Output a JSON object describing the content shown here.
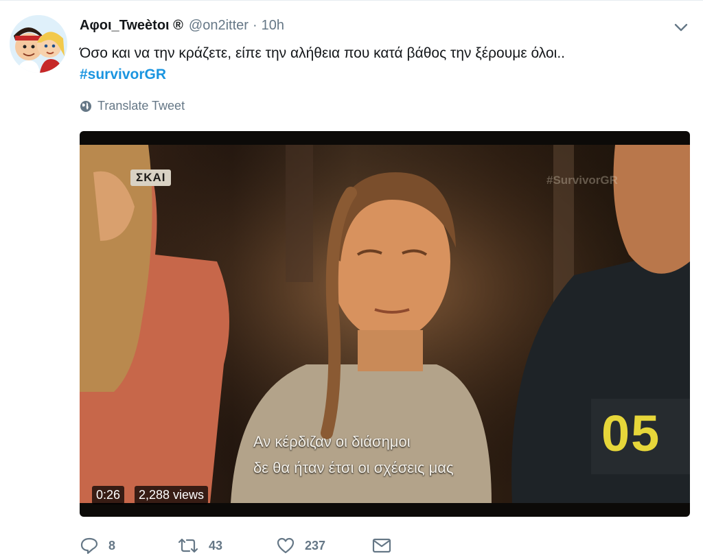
{
  "tweet": {
    "author_name": "Αφοι_Tweètoι ®",
    "handle": "@on2itter",
    "separator": "·",
    "time": "10h",
    "text": "Όσο και να την κράζετε, είπε την αλήθεια που κατά βάθος την ξέρουμε όλοι..",
    "hashtag": "#survivorGR",
    "translate_label": "Translate Tweet"
  },
  "media": {
    "channel_logo": "ΣΚΑΙ",
    "watermark": "#SurvivorGR",
    "subtitle_line1": "Αν κέρδιζαν οι διάσημοι",
    "subtitle_line2": "δε θα ήταν έτσι οι σχέσεις μας",
    "shirt_number": "05",
    "duration": "0:26",
    "views": "2,288 views"
  },
  "actions": {
    "reply_count": "8",
    "retweet_count": "43",
    "like_count": "237"
  },
  "icons": {
    "reply": "reply-icon",
    "retweet": "retweet-icon",
    "like": "heart-icon",
    "dm": "envelope-icon",
    "caret": "chevron-down-icon",
    "globe": "globe-icon"
  },
  "colors": {
    "link": "#1b95e0",
    "secondary_text": "#657786",
    "primary_text": "#14171a"
  }
}
